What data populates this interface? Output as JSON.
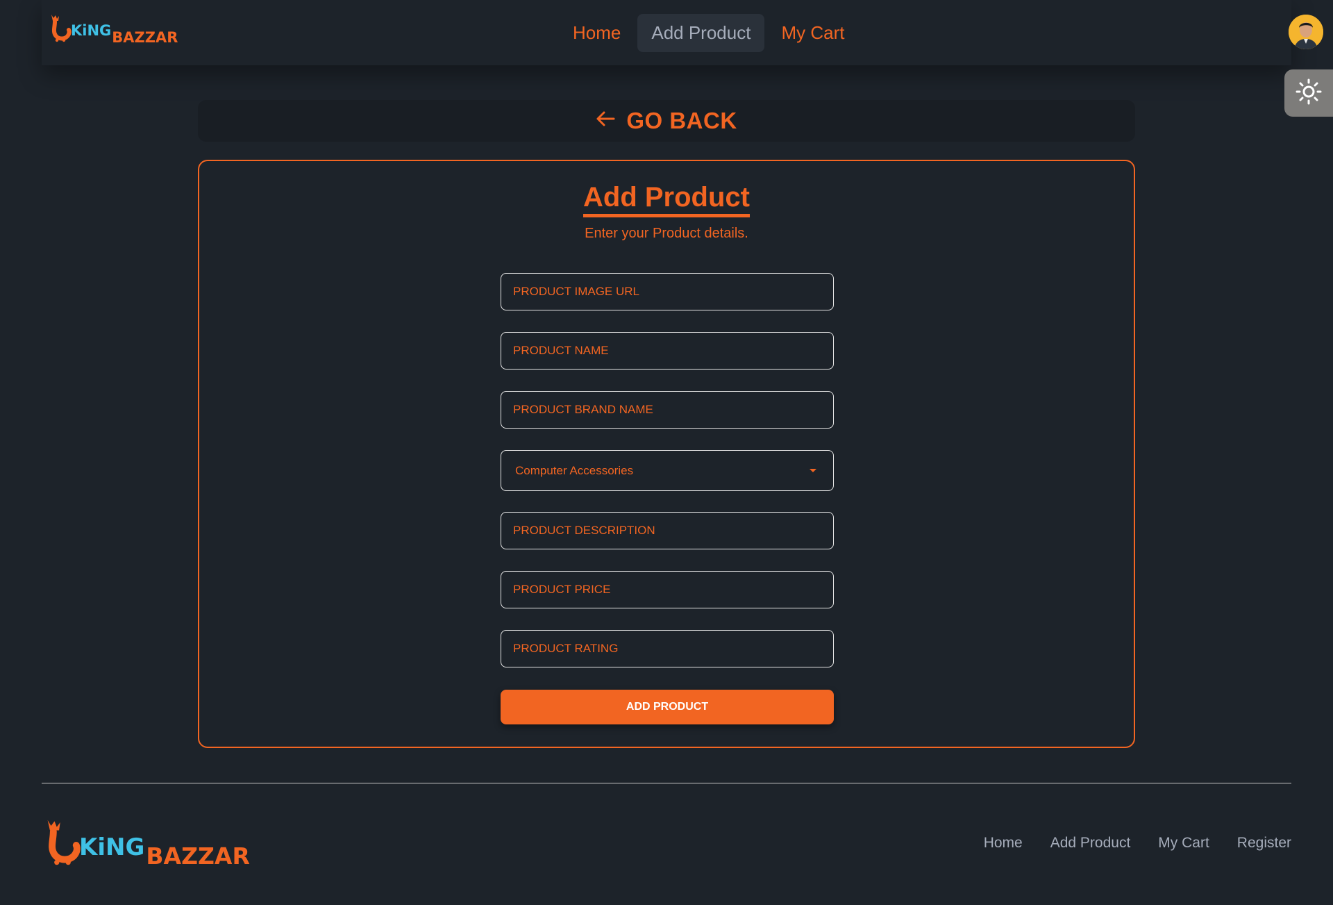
{
  "brand": {
    "part1": "KiNG",
    "part2": "BAZZAR"
  },
  "nav": {
    "items": [
      {
        "label": "Home"
      },
      {
        "label": "Add Product"
      },
      {
        "label": "My Cart"
      }
    ],
    "active": "Add Product"
  },
  "header": {
    "avatar_icon": "user-avatar",
    "theme_icon": "sun-icon"
  },
  "go_back": {
    "label": "GO BACK",
    "icon": "arrow-left-icon"
  },
  "form": {
    "title": "Add Product",
    "subtitle": "Enter your Product details.",
    "fields": {
      "image_url": {
        "placeholder": "PRODUCT IMAGE URL",
        "value": ""
      },
      "name": {
        "placeholder": "PRODUCT NAME",
        "value": ""
      },
      "brand": {
        "placeholder": "PRODUCT BRAND NAME",
        "value": ""
      },
      "category": {
        "selected": "Computer Accessories"
      },
      "description": {
        "placeholder": "PRODUCT DESCRIPTION",
        "value": ""
      },
      "price": {
        "placeholder": "PRODUCT PRICE",
        "value": ""
      },
      "rating": {
        "placeholder": "PRODUCT RATING",
        "value": ""
      }
    },
    "submit_label": "ADD PRODUCT"
  },
  "footer": {
    "links": [
      {
        "label": "Home"
      },
      {
        "label": "Add Product"
      },
      {
        "label": "My Cart"
      },
      {
        "label": "Register"
      }
    ]
  },
  "colors": {
    "accent": "#f26522",
    "brand_blue": "#3fc1e6",
    "background": "#1d232a",
    "text_muted": "#a6adbb"
  }
}
